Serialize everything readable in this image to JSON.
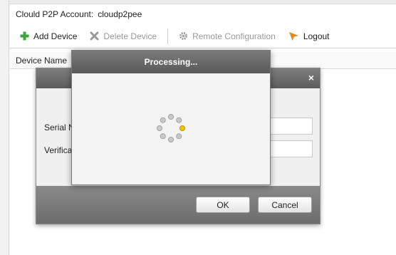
{
  "account": {
    "label": "Clould P2P Account:",
    "value": "cloudp2pee"
  },
  "toolbar": {
    "add_device": "Add Device",
    "delete_device": "Delete Device",
    "remote_configuration": "Remote Configuration",
    "logout": "Logout"
  },
  "table": {
    "col_device_name": "Device Name"
  },
  "dialog": {
    "serial_label": "Serial N",
    "verification_label": "Verifica",
    "close_glyph": "×",
    "ok_label": "OK",
    "cancel_label": "Cancel"
  },
  "processing": {
    "title": "Processing..."
  },
  "colors": {
    "add_icon": "#3aa53a",
    "logout_icon": "#e08a1e",
    "spinner_active": "#f2c200",
    "spinner_dot": "#b5b5b5"
  },
  "icons": [
    "plus-icon",
    "delete-x-icon",
    "gear-icon",
    "logout-arrow-icon",
    "close-icon",
    "spinner-icon"
  ]
}
